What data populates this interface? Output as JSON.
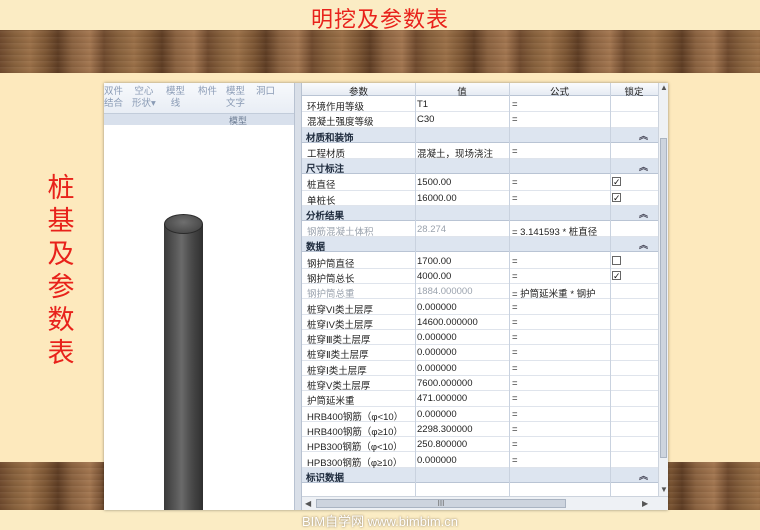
{
  "slide": {
    "title": "明挖及参数表",
    "side_title": [
      "桩",
      "基",
      "及",
      "参",
      "数",
      "表"
    ],
    "footer": "BIM自学网 www.bimbim.cn"
  },
  "ribbon": {
    "items": [
      {
        "label": "双件\n结合"
      },
      {
        "label": "空心\n形状▾"
      },
      {
        "label": "模型\n线"
      },
      {
        "label": "构件"
      },
      {
        "label": "模型\n文字"
      },
      {
        "label": "洞口"
      }
    ],
    "group_label": "模型"
  },
  "table": {
    "headers": {
      "param": "参数",
      "value": "值",
      "formula": "公式",
      "locked": "锁定"
    },
    "rows": [
      {
        "type": "row",
        "param": "环境作用等级",
        "value": "T1",
        "formula": "=",
        "check": "none"
      },
      {
        "type": "row",
        "param": "混凝土强度等级",
        "value": "C30",
        "formula": "=",
        "check": "none"
      },
      {
        "type": "section",
        "title": "材质和装饰"
      },
      {
        "type": "row",
        "param": "工程材质",
        "value": "混凝土，现场浇注",
        "formula": "=",
        "check": "none"
      },
      {
        "type": "section",
        "title": "尺寸标注"
      },
      {
        "type": "row",
        "param": "桩直径",
        "value": "1500.00",
        "formula": "=",
        "check": "checked"
      },
      {
        "type": "row",
        "param": "单桩长",
        "value": "16000.00",
        "formula": "=",
        "check": "checked"
      },
      {
        "type": "section",
        "title": "分析结果"
      },
      {
        "type": "row",
        "dim": true,
        "param": "钢筋混凝土体积",
        "value": "28.274",
        "formula": "= 3.141593 * 桩直径",
        "check": "none"
      },
      {
        "type": "section",
        "title": "数据"
      },
      {
        "type": "row",
        "param": "钢护筒直径",
        "value": "1700.00",
        "formula": "=",
        "check": "empty"
      },
      {
        "type": "row",
        "param": "钢护筒总长",
        "value": "4000.00",
        "formula": "=",
        "check": "checked"
      },
      {
        "type": "row",
        "dim": true,
        "param": "钢护筒总重",
        "value": "1884.000000",
        "formula": "= 护筒延米重 * 钢护",
        "check": "none"
      },
      {
        "type": "row",
        "param": "桩穿VI类土层厚",
        "value": "0.000000",
        "formula": "=",
        "check": "none"
      },
      {
        "type": "row",
        "param": "桩穿IV类土层厚",
        "value": "14600.000000",
        "formula": "=",
        "check": "none"
      },
      {
        "type": "row",
        "param": "桩穿Ⅲ类土层厚",
        "value": "0.000000",
        "formula": "=",
        "check": "none"
      },
      {
        "type": "row",
        "param": "桩穿Ⅱ类土层厚",
        "value": "0.000000",
        "formula": "=",
        "check": "none"
      },
      {
        "type": "row",
        "param": "桩穿Ⅰ类土层厚",
        "value": "0.000000",
        "formula": "=",
        "check": "none"
      },
      {
        "type": "row",
        "param": "桩穿V类土层厚",
        "value": "7600.000000",
        "formula": "=",
        "check": "none"
      },
      {
        "type": "row",
        "param": "护筒延米重",
        "value": "471.000000",
        "formula": "=",
        "check": "none"
      },
      {
        "type": "row",
        "param": "HRB400钢筋（φ<10）",
        "value": "0.000000",
        "formula": "=",
        "check": "none"
      },
      {
        "type": "row",
        "param": "HRB400钢筋（φ≥10）",
        "value": "2298.300000",
        "formula": "=",
        "check": "none"
      },
      {
        "type": "row",
        "param": "HPB300钢筋（φ<10）",
        "value": "250.800000",
        "formula": "=",
        "check": "none"
      },
      {
        "type": "row",
        "param": "HPB300钢筋（φ≥10）",
        "value": "0.000000",
        "formula": "=",
        "check": "none"
      },
      {
        "type": "section",
        "title": "标识数据"
      }
    ]
  },
  "scrollbar": {
    "thumb_label": "III"
  },
  "icons": {
    "collapse": "chevron-up-icon",
    "checkbox": "checkbox-icon"
  }
}
